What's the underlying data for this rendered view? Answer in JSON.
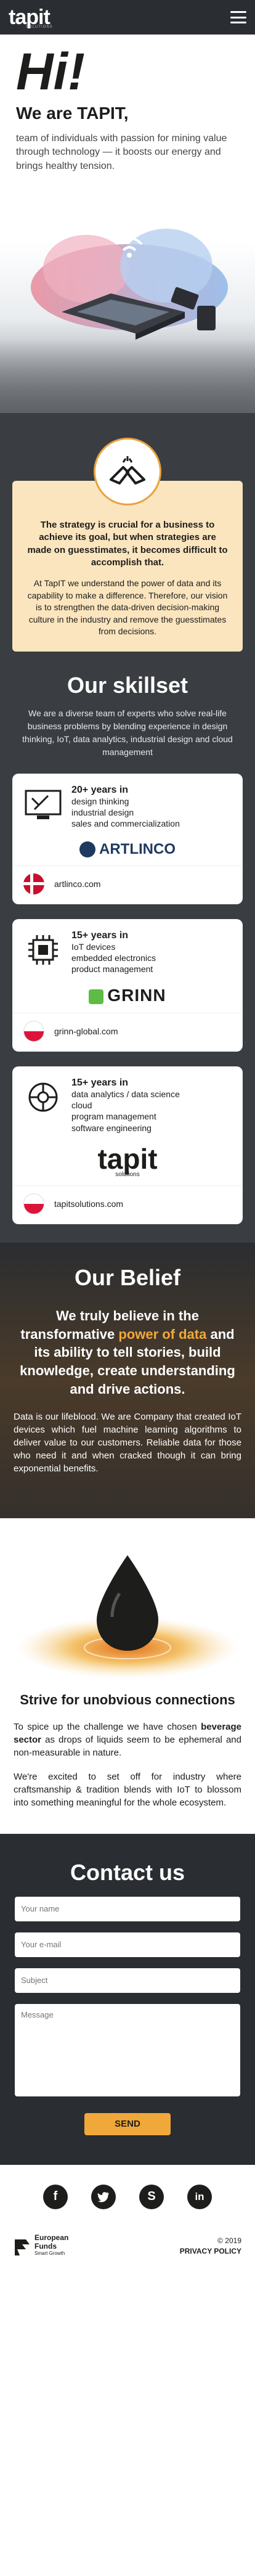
{
  "nav": {
    "logo": "tapit",
    "logo_sub": "SOLUTIONS"
  },
  "hero": {
    "greeting": "Hi!",
    "headline": "We are TAPIT,",
    "intro": "team of individuals with passion for mining value through technology — it boosts our energy and brings healthy tension."
  },
  "mission": {
    "strong": "The strategy is crucial for a business to achieve its goal, but when strategies are made on guesstimates, it becomes difficult to accomplish that.",
    "body": "At TapIT we understand the power of data and its capability to make a difference. Therefore, our vision is to strengthen the data-driven decision-making culture in the industry and remove the guesstimates from decisions."
  },
  "skillset": {
    "title": "Our skillset",
    "desc": "We are a diverse team of experts who solve real-life business problems by blending experience in design thinking, IoT, data analytics, industrial design and cloud management",
    "cards": [
      {
        "head": "20+ years in",
        "lines": [
          "design thinking",
          "industrial design",
          "sales and commercialization"
        ],
        "logo": "ARTLINCO",
        "site": "artlinco.com",
        "icon": "design-icon",
        "flag": "denmark"
      },
      {
        "head": "15+ years in",
        "lines": [
          "IoT devices",
          "embedded electronics",
          "product management"
        ],
        "logo": "GRINN",
        "site": "grinn-global.com",
        "icon": "chip-icon",
        "flag": "poland"
      },
      {
        "head": "15+ years in",
        "lines": [
          "data analytics / data science",
          "cloud",
          "program management",
          "software engineering"
        ],
        "logo": "tapit",
        "logo_sub": "solutions",
        "site": "tapitsolutions.com",
        "icon": "data-icon",
        "flag": "poland"
      }
    ]
  },
  "belief": {
    "title": "Our Belief",
    "lead_1": "We truly believe in the transformative ",
    "lead_hl": "power of data",
    "lead_2": " and its ability to tell stories, build knowledge, create understanding and drive actions.",
    "body": "Data is our lifeblood. We are Company that created IoT devices which fuel machine learning algorithms to deliver value to our customers. Reliable data for those who need it and when cracked though it can bring exponential benefits."
  },
  "drop": {
    "title": "Strive for unobvious connections",
    "p1_a": "To spice up the challenge we have chosen ",
    "p1_b": "beverage sector",
    "p1_c": " as drops of liquids seem to be ephemeral and non-measurable in nature.",
    "p2": "We're excited to set off for industry where craftsmanship & tradition blends with IoT to blossom into something meaningful for the whole ecosystem."
  },
  "contact": {
    "title": "Contact us",
    "name_ph": "Your name",
    "email_ph": "Your e-mail",
    "subject_ph": "Subject",
    "message_ph": "Message",
    "send": "SEND"
  },
  "footer": {
    "socials": [
      "facebook-icon",
      "twitter-icon",
      "skype-icon",
      "linkedin-icon"
    ],
    "eu_1": "European",
    "eu_2": "Funds",
    "eu_3": "Smart Growth",
    "copyright": "© 2019",
    "privacy": "PRIVACY POLICY"
  },
  "colors": {
    "accent": "#f1a83a",
    "dark": "#2a2d31",
    "mission_bg": "#fbe5be"
  }
}
